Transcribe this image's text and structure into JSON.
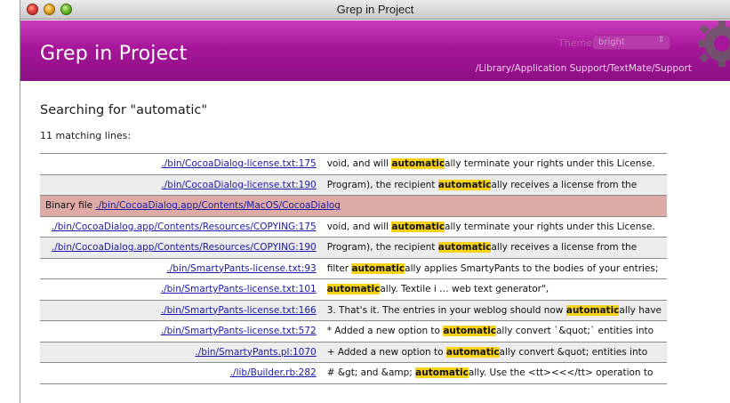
{
  "window": {
    "title": "Grep in Project"
  },
  "banner": {
    "title": "Grep in Project",
    "theme_label": "Theme:",
    "theme_value": "bright",
    "path": "/Library/Application Support/TextMate/Support"
  },
  "search": {
    "heading": "Searching for \"automatic\"",
    "count": "11 matching lines:",
    "term": "automatic"
  },
  "results": [
    {
      "file": "./bin/CocoaDialog-license.txt:175",
      "pre": "void, and will ",
      "hit": "automatic",
      "post": "ally terminate your rights under this License.",
      "shaded": false
    },
    {
      "file": "./bin/CocoaDialog-license.txt:190",
      "pre": "Program), the recipient ",
      "hit": "automatic",
      "post": "ally receives a license from the",
      "shaded": true
    },
    {
      "binary_label": "Binary file ",
      "file": "./bin/CocoaDialog.app/Contents/MacOS/CocoaDialog",
      "binary": true
    },
    {
      "file": "./bin/CocoaDialog.app/Contents/Resources/COPYING:175",
      "pre": "void, and will ",
      "hit": "automatic",
      "post": "ally terminate your rights under this License.",
      "shaded": false
    },
    {
      "file": "./bin/CocoaDialog.app/Contents/Resources/COPYING:190",
      "pre": "Program), the recipient ",
      "hit": "automatic",
      "post": "ally receives a license from the",
      "shaded": true
    },
    {
      "file": "./bin/SmartyPants-license.txt:93",
      "pre": "filter ",
      "hit": "automatic",
      "post": "ally applies SmartyPants to the bodies of your entries;",
      "shaded": false
    },
    {
      "file": "./bin/SmartyPants-license.txt:101",
      "pre": "",
      "hit": "automatic",
      "post": "ally. Textile i … web text generator\",",
      "shaded": false
    },
    {
      "file": "./bin/SmartyPants-license.txt:166",
      "pre": "3. That's it. The entries in your weblog should now ",
      "hit": "automatic",
      "post": "ally have",
      "shaded": true
    },
    {
      "file": "./bin/SmartyPants-license.txt:572",
      "pre": "* Added a new option to ",
      "hit": "automatic",
      "post": "ally convert `&quot;` entities into",
      "shaded": false
    },
    {
      "file": "./bin/SmartyPants.pl:1070",
      "pre": "+ Added a new option to ",
      "hit": "automatic",
      "post": "ally convert &quot; entities into",
      "shaded": true
    },
    {
      "file": "./lib/Builder.rb:282",
      "pre": "# &gt; and &amp; ",
      "hit": "automatic",
      "post": "ally. Use the <tt><<</tt> operation to",
      "shaded": false
    }
  ]
}
